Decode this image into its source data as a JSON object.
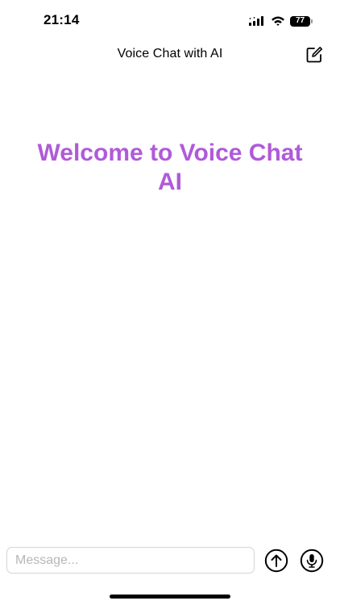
{
  "status_bar": {
    "time": "21:14",
    "battery_level": "77",
    "icons": [
      "cellular-signal-icon",
      "wifi-icon",
      "battery-icon"
    ]
  },
  "nav": {
    "title": "Voice Chat with AI",
    "compose_icon": "compose-icon"
  },
  "main": {
    "welcome_text": "Welcome to Voice Chat AI",
    "accent_color": "#b05ad9"
  },
  "composer": {
    "input_value": "",
    "input_placeholder": "Message...",
    "send_icon": "arrow-up-circle-icon",
    "mic_icon": "microphone-circle-icon"
  }
}
